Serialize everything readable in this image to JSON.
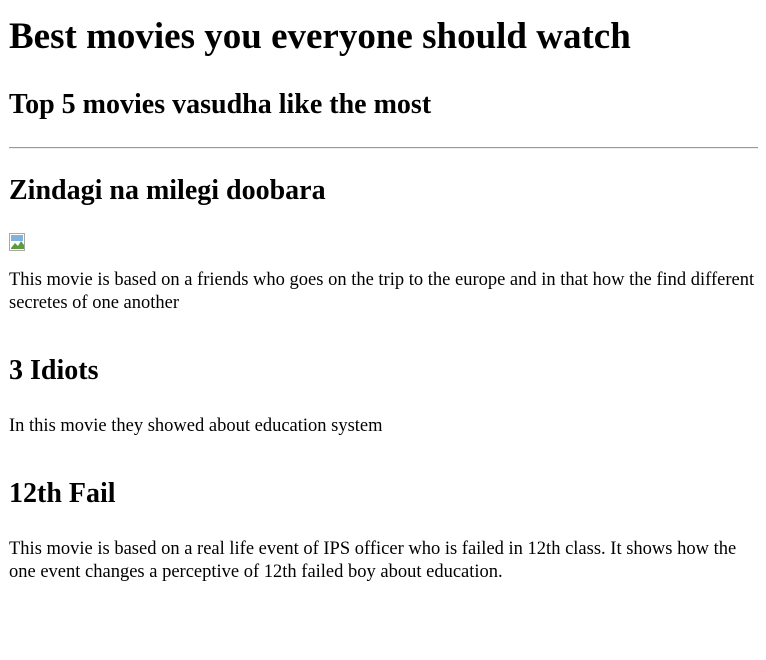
{
  "page": {
    "title": "Best movies you everyone should watch",
    "subtitle": "Top 5 movies vasudha like the most"
  },
  "movies": [
    {
      "title": "Zindagi na milegi doobara",
      "has_image": true,
      "description": "This movie is based on a friends who goes on the trip to the europe and in that how the find different secretes of one another"
    },
    {
      "title": "3 Idiots",
      "description": "In this movie they showed about education system"
    },
    {
      "title": "12th Fail",
      "description": "This movie is based on a real life event of IPS officer who is failed in 12th class. It shows how the one event changes a perceptive of 12th failed boy about education."
    }
  ]
}
